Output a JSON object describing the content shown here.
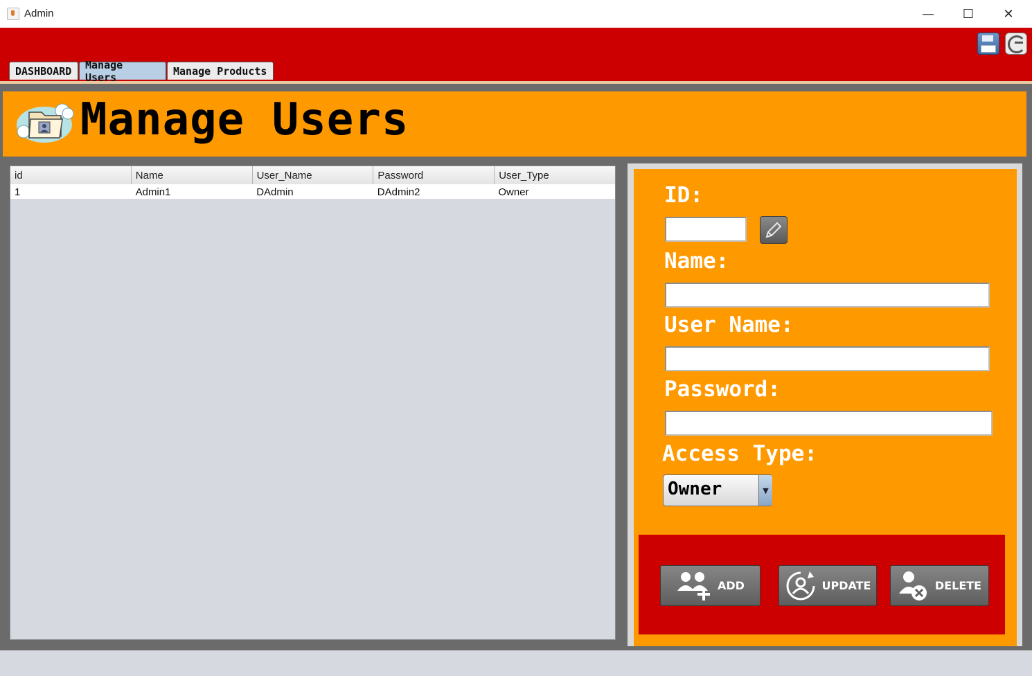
{
  "window": {
    "title": "Admin",
    "minimize": "—",
    "maximize": "☐",
    "close": "✕"
  },
  "header": {
    "icons": [
      "save-icon",
      "logout-icon"
    ]
  },
  "tabs": [
    {
      "label": "DASHBOARD",
      "active": false
    },
    {
      "label": "Manage Users",
      "active": true
    },
    {
      "label": "Manage Products",
      "active": false
    }
  ],
  "page": {
    "title": "Manage Users",
    "icon": "users-folder-icon"
  },
  "table": {
    "columns": [
      "id",
      "Name",
      "User_Name",
      "Password",
      "User_Type"
    ],
    "rows": [
      [
        "1",
        "Admin1",
        "DAdmin",
        "DAdmin2",
        "Owner"
      ]
    ]
  },
  "form": {
    "id_label": "ID:",
    "id_value": "",
    "name_label": "Name:",
    "name_value": "",
    "username_label": "User Name:",
    "username_value": "",
    "password_label": "Password:",
    "password_value": "",
    "access_label": "Access Type:",
    "access_value": "Owner"
  },
  "buttons": {
    "add": "ADD",
    "update": "UPDATE",
    "delete": "DELETE"
  },
  "colors": {
    "title_red": "#cc0000",
    "accent_orange": "#ff9900",
    "frame_gray": "#6b6b6b"
  }
}
